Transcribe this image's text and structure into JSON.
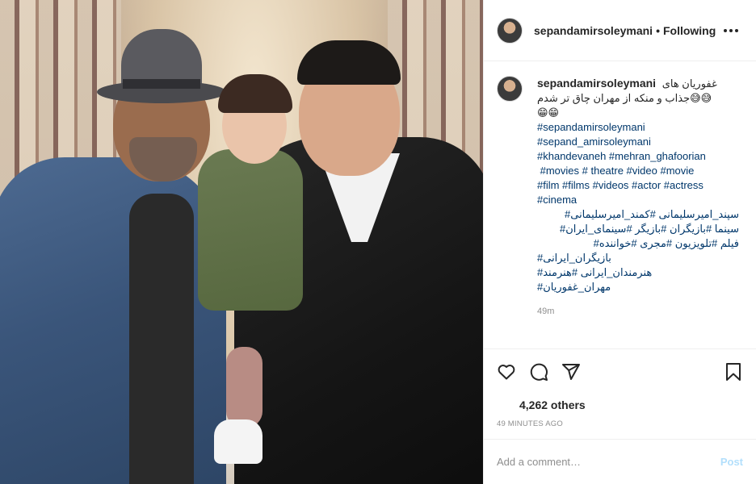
{
  "post": {
    "username": "sepandamirsoleymani",
    "separator": "•",
    "follow_status": "Following"
  },
  "caption": {
    "username": "sepandamirsoleymani",
    "line1": "غفوریان های",
    "line2": "😅😅جذاب و منکه از مهران چاق تر شدم",
    "line3": "😁😁",
    "hashtags": [
      "#sepandamirsoleymani",
      "#sepand_amirsoleymani",
      "#khandevaneh #mehran_ghafoorian",
      " #movies # theatre #video #movie",
      "#film #films #videos #actor #actress",
      "#cinema"
    ],
    "rtl_hashtags": [
      "سپند_امیرسلیمانی #کمند_امیرسلیمانی#",
      "سینما #بازیگران #بازیگر #سینمای_ایران#",
      "فیلم #تلویزیون #مجری #خواننده#",
      "بازیگران_ایرانی#",
      "هنرمندان_ایرانی #هنرمند#",
      "مهران_غفوریان#"
    ],
    "time": "49m"
  },
  "actions": {
    "like_icon": "heart-icon",
    "comment_icon": "comment-icon",
    "share_icon": "share-icon",
    "save_icon": "bookmark-icon"
  },
  "likes": "4,262 others",
  "posted_ago": "49 MINUTES AGO",
  "comment": {
    "placeholder": "Add a comment…",
    "post_label": "Post"
  },
  "colors": {
    "hashtag": "#00376b",
    "post_disabled": "#b2dffc",
    "border": "#efefef",
    "meta": "#8e8e8e"
  }
}
